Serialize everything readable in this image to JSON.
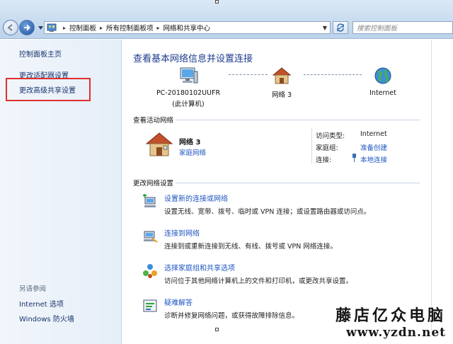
{
  "toolbar": {
    "breadcrumbs": [
      "控制面板",
      "所有控制面板项",
      "网络和共享中心"
    ],
    "search_placeholder": "搜索控制面板"
  },
  "sidebar": {
    "items": [
      "控制面板主页",
      "更改适配器设置",
      "更改高级共享设置"
    ],
    "see_also_title": "另请参阅",
    "see_also": [
      "Internet 选项",
      "Windows 防火墙"
    ]
  },
  "main": {
    "title": "查看基本网络信息并设置连接",
    "map": {
      "computer_name": "PC-20180102UUFR",
      "computer_sub": "(此计算机)",
      "network_label": "网络  3",
      "internet_label": "Internet"
    },
    "active": {
      "header": "查看活动网络",
      "network_name": "网络  3",
      "network_type": "家庭网络",
      "fields": [
        {
          "label": "访问类型:",
          "value": "Internet"
        },
        {
          "label": "家庭组:",
          "value": "准备创建"
        },
        {
          "label": "连接:",
          "value": "本地连接"
        }
      ]
    },
    "change_header": "更改网络设置",
    "tasks": [
      {
        "title": "设置新的连接或网络",
        "desc": "设置无线、宽带、拨号、临时或 VPN 连接；或设置路由器或访问点。"
      },
      {
        "title": "连接到网络",
        "desc": "连接到或重新连接到无线、有线、拨号或 VPN 网络连接。"
      },
      {
        "title": "选择家庭组和共享选项",
        "desc": "访问位于其他网络计算机上的文件和打印机，或更改共享设置。"
      },
      {
        "title": "疑难解答",
        "desc": "诊断并修复网络问题，或获得故障排除信息。"
      }
    ]
  },
  "watermark": {
    "name": "藤店亿众电脑",
    "url": "www.yzdn.net"
  },
  "colors": {
    "link": "#1e56c2",
    "title": "#1d3b8f",
    "highlight": "#e0302e"
  }
}
